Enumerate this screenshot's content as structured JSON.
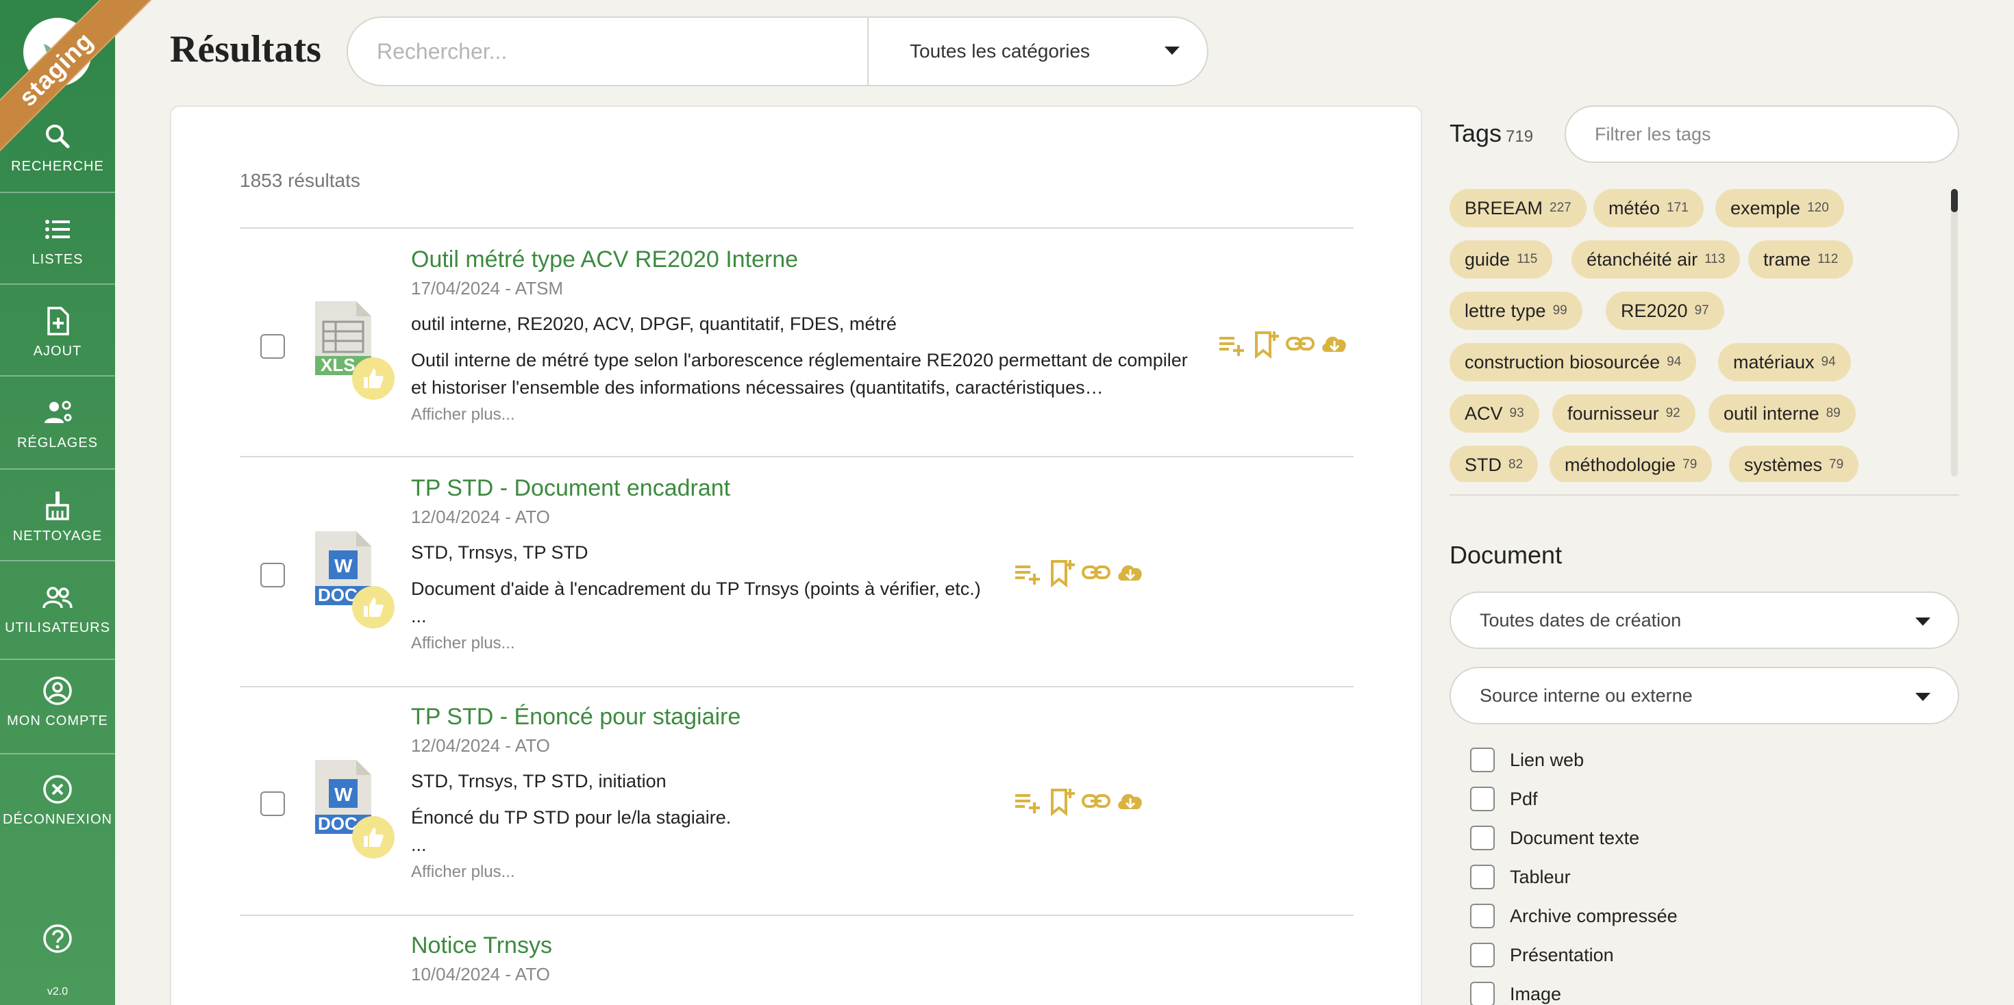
{
  "env_ribbon": "staging",
  "version": "v2.0",
  "sidebar": {
    "items": [
      {
        "label": "RECHERCHE",
        "icon": "search-icon"
      },
      {
        "label": "LISTES",
        "icon": "list-icon"
      },
      {
        "label": "AJOUT",
        "icon": "file-add-icon"
      },
      {
        "label": "RÉGLAGES",
        "icon": "user-settings-icon"
      },
      {
        "label": "NETTOYAGE",
        "icon": "broom-icon"
      },
      {
        "label": "UTILISATEURS",
        "icon": "users-icon"
      },
      {
        "label": "MON COMPTE",
        "icon": "account-circle-icon"
      },
      {
        "label": "DÉCONNEXION",
        "icon": "logout-icon"
      }
    ],
    "help_icon": "help-icon"
  },
  "header": {
    "title": "Résultats",
    "search_placeholder": "Rechercher...",
    "category_select": "Toutes les catégories"
  },
  "results": {
    "count_text": "1853 résultats",
    "items": [
      {
        "title": "Outil métré type ACV RE2020 Interne",
        "meta": "17/04/2024 - ATSM",
        "tags": "outil interne, RE2020, ACV, DPGF, quantitatif, FDES, métré",
        "description": "Outil interne de métré type selon l'arborescence réglementaire RE2020 permettant de compiler et historiser l'ensemble des informations nécessaires (quantitatifs, caractéristiques…",
        "more": "Afficher plus...",
        "file_type": "XLS",
        "icon": "spreadsheet-file-icon"
      },
      {
        "title": "TP STD - Document encadrant",
        "meta": "12/04/2024 - ATO",
        "tags": "STD, Trnsys, TP STD",
        "description": "Document d'aide à l'encadrement du TP Trnsys (points à vérifier, etc.)",
        "ellipsis": "...",
        "more": "Afficher plus...",
        "file_type": "DOC",
        "icon": "word-file-icon"
      },
      {
        "title": "TP STD - Énoncé pour stagiaire",
        "meta": "12/04/2024 - ATO",
        "tags": "STD, Trnsys, TP STD, initiation",
        "description": "Énoncé du TP STD pour le/la stagiaire.",
        "ellipsis": "...",
        "more": "Afficher plus...",
        "file_type": "DOC",
        "icon": "word-file-icon"
      },
      {
        "title": "Notice Trnsys",
        "meta": "10/04/2024 - ATO"
      }
    ]
  },
  "tags_panel": {
    "title": "Tags",
    "count": "719",
    "filter_placeholder": "Filtrer les tags",
    "tags": [
      {
        "label": "BREEAM",
        "count": "227"
      },
      {
        "label": "météo",
        "count": "171"
      },
      {
        "label": "exemple",
        "count": "120"
      },
      {
        "label": "guide",
        "count": "115"
      },
      {
        "label": "étanchéité air",
        "count": "113"
      },
      {
        "label": "trame",
        "count": "112"
      },
      {
        "label": "lettre type",
        "count": "99"
      },
      {
        "label": "RE2020",
        "count": "97"
      },
      {
        "label": "construction biosourcée",
        "count": "94"
      },
      {
        "label": "matériaux",
        "count": "94"
      },
      {
        "label": "ACV",
        "count": "93"
      },
      {
        "label": "fournisseur",
        "count": "92"
      },
      {
        "label": "outil interne",
        "count": "89"
      },
      {
        "label": "STD",
        "count": "82"
      },
      {
        "label": "méthodologie",
        "count": "79"
      },
      {
        "label": "systèmes",
        "count": "79"
      }
    ]
  },
  "document_panel": {
    "title": "Document",
    "date_select": "Toutes dates de création",
    "source_select": "Source interne ou externe",
    "types": [
      "Lien web",
      "Pdf",
      "Document texte",
      "Tableur",
      "Archive compressée",
      "Présentation",
      "Image"
    ]
  },
  "colors": {
    "sidebar": "#3f8f52",
    "accent_green": "#3c8a3f",
    "tag_chip": "#eedfb3",
    "action_gold": "#d9b33f",
    "ribbon": "#c8873f"
  }
}
